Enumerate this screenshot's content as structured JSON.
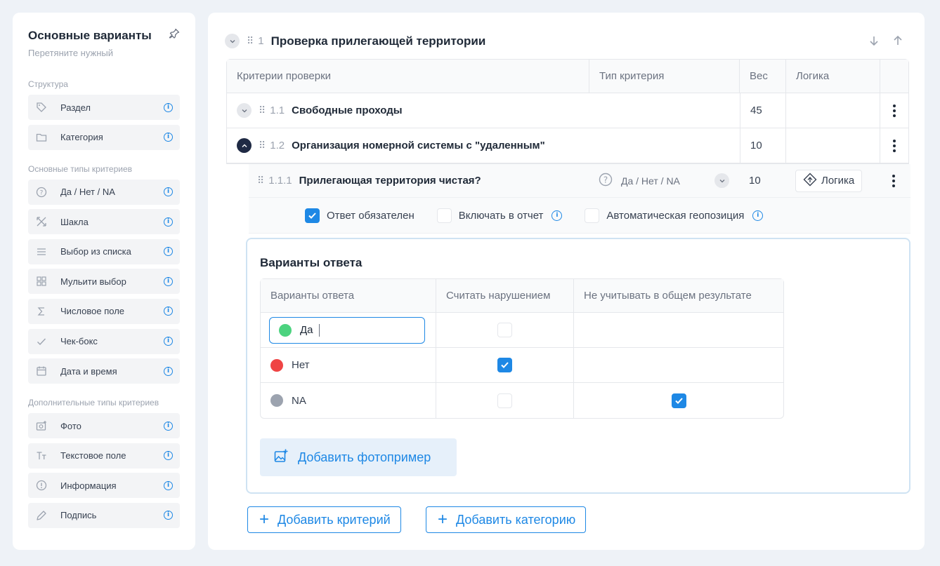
{
  "sidebar": {
    "title": "Основные варианты",
    "subtitle": "Перетяните нужный",
    "sections": [
      {
        "label": "Структура",
        "items": [
          {
            "label": "Раздел",
            "icon": "tag-icon"
          },
          {
            "label": "Категория",
            "icon": "folder-icon"
          }
        ]
      },
      {
        "label": "Основные типы критериев",
        "items": [
          {
            "label": "Да / Нет / NA",
            "icon": "question-icon"
          },
          {
            "label": "Шакла",
            "icon": "scale-icon"
          },
          {
            "label": "Выбор из списка",
            "icon": "list-icon"
          },
          {
            "label": "Мульити выбор",
            "icon": "grid-icon"
          },
          {
            "label": "Числовое поле",
            "icon": "sigma-icon"
          },
          {
            "label": "Чек-бокс",
            "icon": "check-icon"
          },
          {
            "label": "Дата и время",
            "icon": "calendar-icon"
          }
        ]
      },
      {
        "label": "Дополнительные типы критериев",
        "items": [
          {
            "label": "Фото",
            "icon": "camera-icon"
          },
          {
            "label": "Текстовое поле",
            "icon": "text-icon"
          },
          {
            "label": "Информация",
            "icon": "info-circle-icon"
          },
          {
            "label": "Подпись",
            "icon": "pen-icon"
          }
        ]
      }
    ]
  },
  "section": {
    "number": "1",
    "title": "Проверка прилегающей территории"
  },
  "table": {
    "headers": [
      "Критерии проверки",
      "Тип критерия",
      "Вес",
      "Логика"
    ],
    "rows": [
      {
        "number": "1.1",
        "title": "Свободные проходы",
        "weight": "45"
      },
      {
        "number": "1.2",
        "title": "Организация номерной системы с \"удаленным\"",
        "weight": "10"
      }
    ],
    "subrow": {
      "number": "1.1.1",
      "title": "Прилегающая территория чистая?",
      "type": "Да / Нет / NA",
      "weight": "10",
      "logic_label": "Логика",
      "options": [
        {
          "label": "Ответ обязателен",
          "checked": true
        },
        {
          "label": "Включать в отчет",
          "checked": false
        },
        {
          "label": "Автоматическая геопозиция",
          "checked": false
        }
      ]
    }
  },
  "variants": {
    "title": "Варианты ответа",
    "headers": [
      "Варианты ответа",
      "Считать нарушением",
      "Не учитывать в общем результате"
    ],
    "rows": [
      {
        "label": "Да",
        "color": "#4cd37f",
        "violation": false,
        "exclude": false
      },
      {
        "label": "Нет",
        "color": "#ef4444",
        "violation": true,
        "exclude": false
      },
      {
        "label": "NA",
        "color": "#9ca3af",
        "violation": false,
        "exclude": true
      }
    ],
    "photo_button": "Добавить фотопример"
  },
  "footer": {
    "add_criterion": "Добавить критерий",
    "add_category": "Добавить категорию"
  }
}
